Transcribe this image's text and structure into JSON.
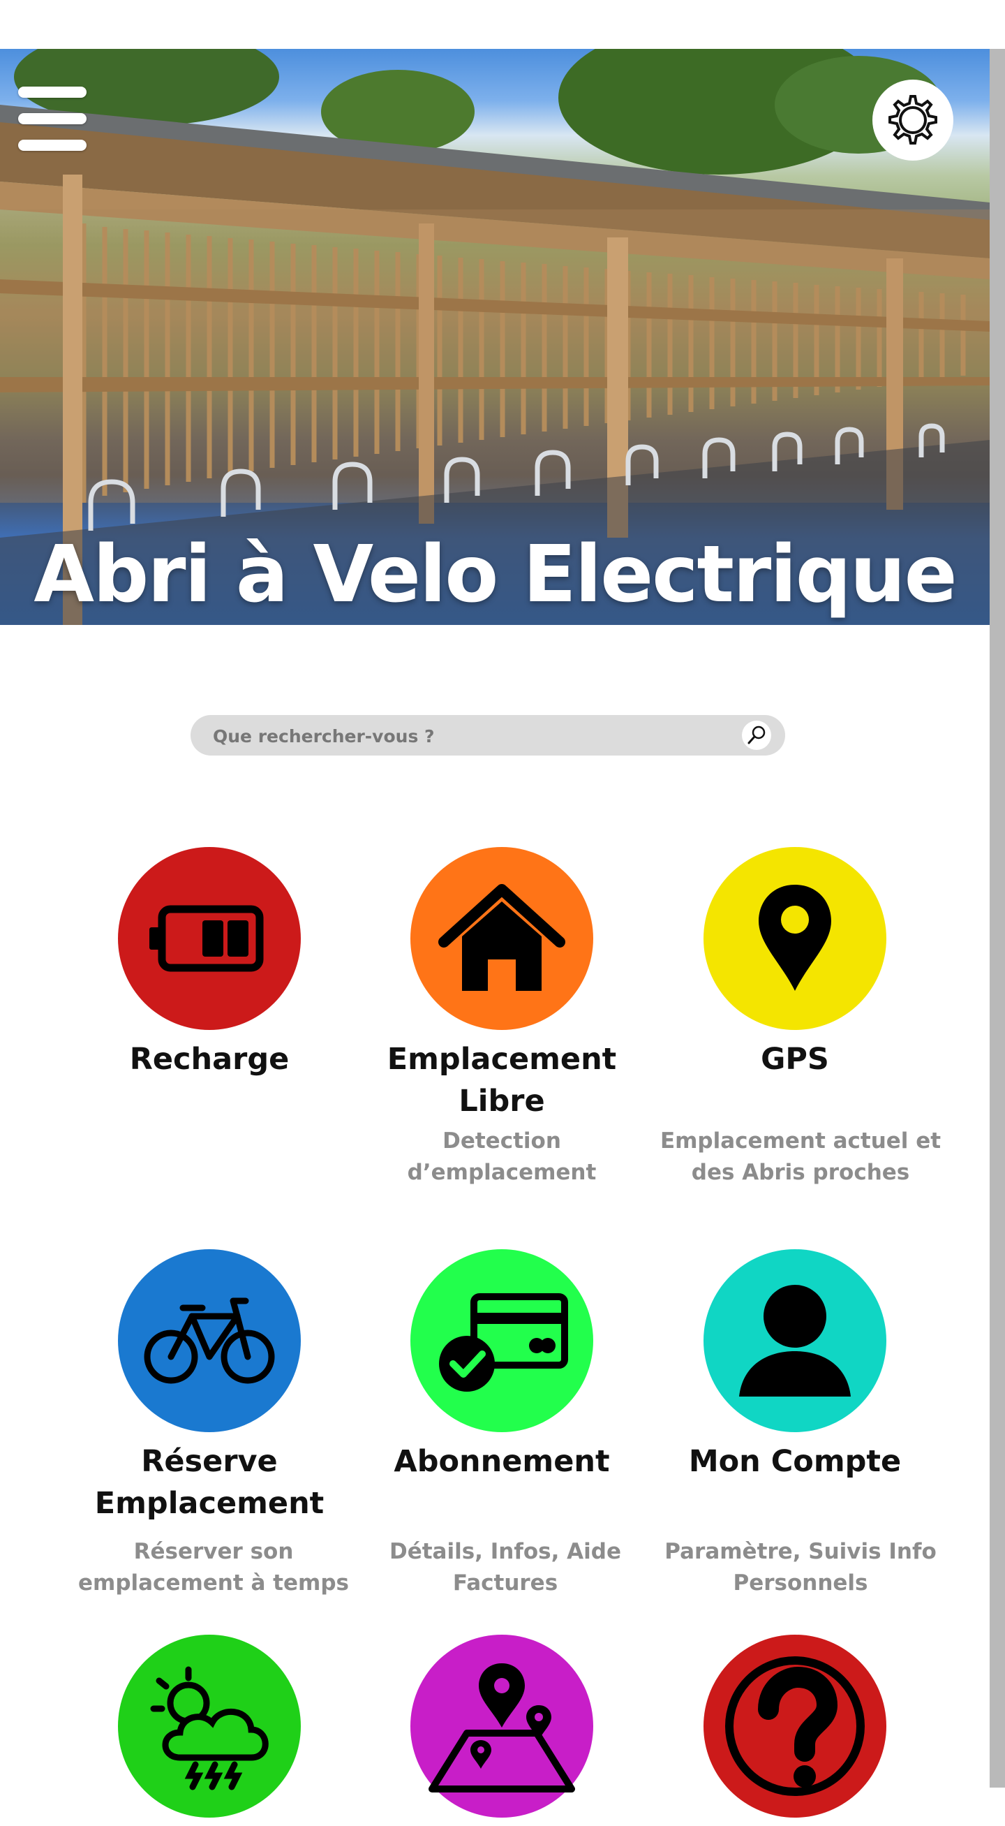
{
  "hero": {
    "title": "Abri à Velo Electrique"
  },
  "header": {
    "menu_icon": "hamburger-menu-icon",
    "settings_icon": "gear-icon"
  },
  "search": {
    "placeholder": "Que rechercher-vous ?",
    "icon": "search-icon"
  },
  "tiles": [
    {
      "label": "Recharge",
      "desc": "",
      "color": "#cc1a1a",
      "icon": "battery-icon"
    },
    {
      "label": "Emplacement Libre",
      "desc": "Detection d’emplacement",
      "color": "#ff7417",
      "icon": "house-icon"
    },
    {
      "label": "GPS",
      "desc": "Emplacement actuel et des Abris proches",
      "color": "#f4e500",
      "icon": "location-pin-icon"
    },
    {
      "label": "Réserve Emplacement",
      "desc": "Réserver son emplacement à temps",
      "color": "#1a79d0",
      "icon": "bicycle-icon"
    },
    {
      "label": "Abonnement",
      "desc": "Détails, Infos, Aide Factures",
      "color": "#22ff4c",
      "icon": "credit-card-check-icon"
    },
    {
      "label": "Mon Compte",
      "desc": "Paramètre, Suivis Info Personnels",
      "color": "#10d6c4",
      "icon": "user-icon"
    },
    {
      "label": "",
      "desc": "",
      "color": "#1fd018",
      "icon": "weather-storm-icon"
    },
    {
      "label": "",
      "desc": "",
      "color": "#c81ec8",
      "icon": "map-pins-icon"
    },
    {
      "label": "",
      "desc": "",
      "color": "#cc1a1a",
      "icon": "help-question-icon"
    }
  ]
}
